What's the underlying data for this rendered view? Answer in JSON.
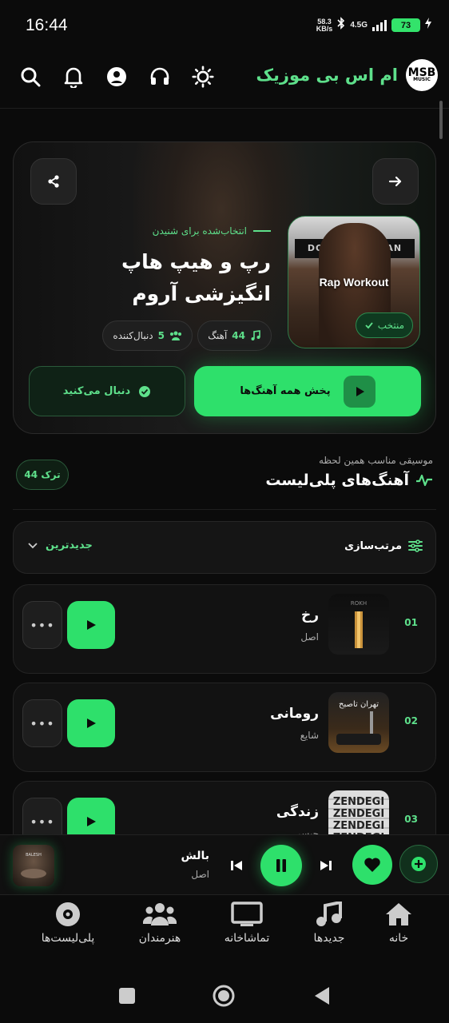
{
  "status": {
    "time": "16:44",
    "net_speed_value": "58.3",
    "net_speed_unit": "KB/s",
    "network": "4.5G",
    "battery": "73"
  },
  "header": {
    "app_name": "ام اس بی موزیک",
    "logo_text": "MSB",
    "logo_sub": "MUSIC"
  },
  "hero": {
    "eyebrow": "انتخاب‌شده برای شنیدن",
    "title": "رپ و هیپ هاپ انگیزشی آروم",
    "cover_title": "Rap Workout",
    "cover_sign": "DOWNTOWN TAN",
    "featured_badge": "منتخب",
    "songs_count": "44",
    "songs_label": "آهنگ",
    "followers_count": "5",
    "followers_label": "دنبال‌کننده",
    "play_all_label": "پخش همه آهنگ‌ها",
    "follow_label": "دنبال می‌کنید"
  },
  "section": {
    "subtitle": "موسیقی مناسب همین لحظه",
    "title": "آهنگ‌های پلی‌لیست",
    "count_badge": "44 ترک"
  },
  "sort": {
    "label": "مرتب‌سازی",
    "value": "جدیدترین"
  },
  "tracks": [
    {
      "num": "01",
      "name": "رخ",
      "sub": "اصل",
      "art_text": "ROKH"
    },
    {
      "num": "02",
      "name": "رومانی",
      "sub": "شایع",
      "art_text": "تهران تاصبح"
    },
    {
      "num": "03",
      "name": "زندگی",
      "sub": "جیسر",
      "art_text": "ZENDEGI"
    }
  ],
  "player": {
    "name": "بالش",
    "sub": "اصل",
    "art_text": "BALESH"
  },
  "nav": {
    "home": "خانه",
    "new": "جدیدها",
    "theater": "تماشاخانه",
    "artists": "هنرمندان",
    "playlists": "پلی‌لیست‌ها"
  },
  "colors": {
    "accent": "#2ee06b",
    "accent_text": "#5ee08b",
    "background": "#0b0b0b",
    "card": "#121212"
  },
  "icons": {
    "header": [
      "search-icon",
      "bell-icon",
      "user-icon",
      "headset-icon",
      "sun-icon"
    ],
    "hero": [
      "share-icon",
      "arrow-right-icon",
      "music-note-icon",
      "users-icon",
      "play-icon",
      "check-circle-icon"
    ],
    "nav": [
      "home-icon",
      "music-icon",
      "tv-icon",
      "users-icon",
      "disc-icon"
    ]
  }
}
